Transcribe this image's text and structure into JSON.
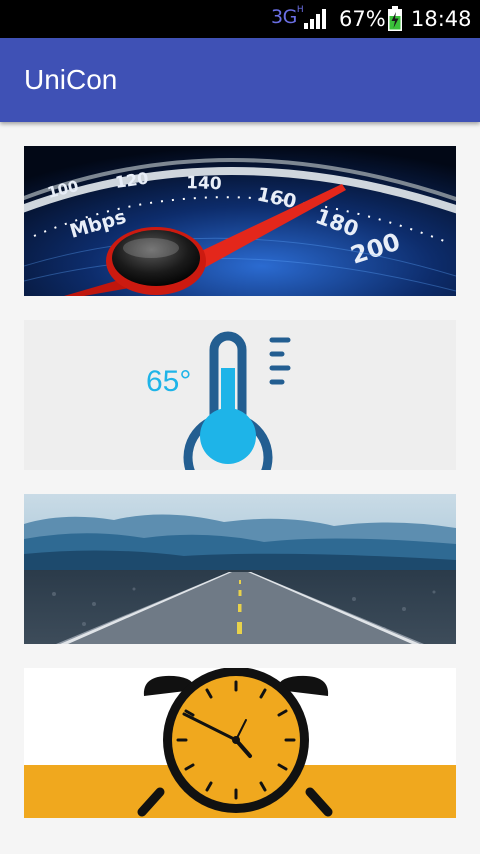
{
  "status_bar": {
    "network": "3G",
    "network_sup": "H",
    "battery_percent": "67%",
    "time": "18:48"
  },
  "app_bar": {
    "title": "UniCon"
  },
  "cards": [
    {
      "icon": "speedometer-mbps-image",
      "dial_labels": [
        "100",
        "120",
        "140",
        "160",
        "180",
        "200"
      ],
      "unit": "Mbps"
    },
    {
      "icon": "thermometer-image",
      "temperature": "65°"
    },
    {
      "icon": "road-landscape-image"
    },
    {
      "icon": "alarm-clock-image"
    }
  ],
  "colors": {
    "app_bar": "#3f51b5",
    "status_bar": "#000000",
    "background": "#f5f5f5",
    "thermo_blue": "#1eb4e8",
    "thermo_dark": "#235e91",
    "clock_orange": "#f0a81e"
  }
}
